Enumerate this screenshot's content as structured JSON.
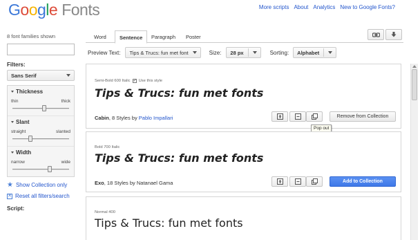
{
  "header": {
    "logo_letters": [
      "G",
      "o",
      "o",
      "g",
      "l",
      "e"
    ],
    "logo_product": "Fonts",
    "links": [
      "More scripts",
      "About",
      "Analytics",
      "New to Google Fonts?"
    ]
  },
  "sidebar": {
    "count_text": "8 font families shown",
    "search_placeholder": "",
    "filters_label": "Filters:",
    "category_value": "Sans Serif",
    "filters": [
      {
        "title": "Thickness",
        "min_label": "thin",
        "max_label": "thick",
        "min_value": 0,
        "max_value": 0.56
      },
      {
        "title": "Slant",
        "min_label": "straight",
        "max_label": "slanted",
        "min_value": 0,
        "max_value": 0.31
      },
      {
        "title": "Width",
        "min_label": "narrow",
        "max_label": "wide",
        "min_value": 0,
        "max_value": 0.66
      }
    ],
    "show_collection": "Show Collection only",
    "reset": "Reset all filters/search",
    "script_label": "Script:"
  },
  "tabs": [
    "Word",
    "Sentence",
    "Paragraph",
    "Poster"
  ],
  "active_tab": "Sentence",
  "toolbar": {
    "preview_label": "Preview Text:",
    "preview_value": "Tips & Trucs: fun met font",
    "size_label": "Size:",
    "size_value": "28 px",
    "sorting_label": "Sorting:",
    "sorting_value": "Alphabet"
  },
  "cards": [
    {
      "style_label": "Semi-Bold 600 Italic",
      "use_style": "Use this style",
      "sample": "Tips & Trucs: fun met fonts",
      "family": "Cabin",
      "styles_text": ", 8 Styles by ",
      "designer": "Pablo Impallari",
      "action": "Remove from Collection"
    },
    {
      "style_label": "Bold 700 Italic",
      "sample": "Tips & Trucs: fun met fonts",
      "family": "Exo",
      "styles_text": ", 18 Styles by ",
      "designer": "Natanael Gama",
      "action": "Add to Collection"
    },
    {
      "style_label": "Normal 400",
      "sample": "Tips & Trucs: fun met fonts"
    }
  ],
  "tooltip": "Pop out",
  "icons": [
    "link-icon",
    "download-icon",
    "quick-use-icon",
    "review-icon",
    "pop-out-icon",
    "star-icon",
    "reset-icon"
  ],
  "colors": {
    "link": "#2255cc",
    "add_button": "#4a85ef",
    "logo_blue": "#3c78d8",
    "logo_red": "#dd4b39",
    "logo_yellow": "#f6b400",
    "logo_green": "#1e9e55"
  }
}
